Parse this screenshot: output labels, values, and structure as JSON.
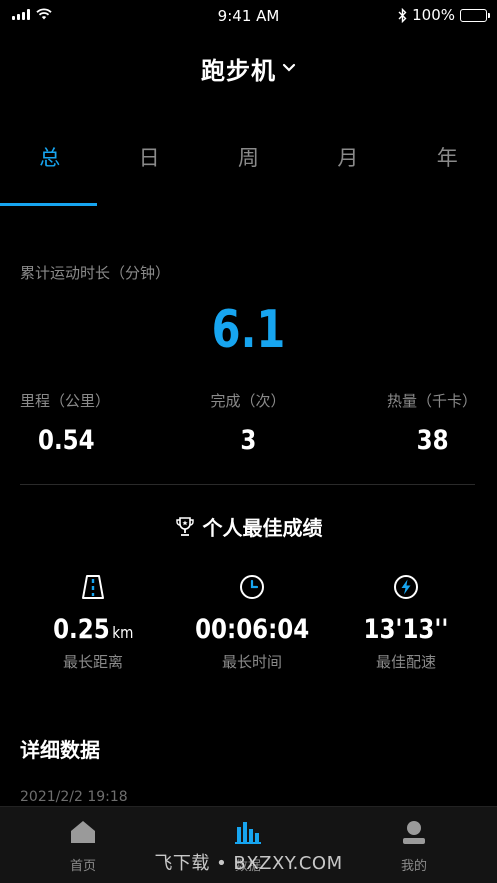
{
  "status_bar": {
    "time": "9:41 AM",
    "battery": "100%",
    "battery_level": 1.0
  },
  "header": {
    "title": "跑步机"
  },
  "tabs": [
    {
      "label": "总",
      "active": true
    },
    {
      "label": "日",
      "active": false
    },
    {
      "label": "周",
      "active": false
    },
    {
      "label": "月",
      "active": false
    },
    {
      "label": "年",
      "active": false
    }
  ],
  "summary": {
    "total_label": "累计运动时长（分钟）",
    "total_value": "6.1",
    "stats": [
      {
        "label": "里程（公里）",
        "value": "0.54"
      },
      {
        "label": "完成（次）",
        "value": "3"
      },
      {
        "label": "热量（千卡）",
        "value": "38"
      }
    ]
  },
  "best": {
    "title": "个人最佳成绩",
    "items": [
      {
        "icon": "road-icon",
        "value": "0.25",
        "unit": "km",
        "label": "最长距离"
      },
      {
        "icon": "clock-icon",
        "value": "00:06:04",
        "unit": "",
        "label": "最长时间"
      },
      {
        "icon": "lightning-icon",
        "value": "13'13''",
        "unit": "",
        "label": "最佳配速"
      }
    ]
  },
  "details": {
    "title": "详细数据",
    "date": "2021/2/2 19:18"
  },
  "bottom_nav": [
    {
      "icon": "home-icon",
      "label": "首页",
      "active": false
    },
    {
      "icon": "bar-chart-icon",
      "label": "数据",
      "active": true
    },
    {
      "icon": "person-icon",
      "label": "我的",
      "active": false
    }
  ],
  "watermark": "飞下载 • BXZXY.COM",
  "colors": {
    "accent": "#17a5f0",
    "background": "#000000",
    "muted": "#8a8a8a"
  }
}
